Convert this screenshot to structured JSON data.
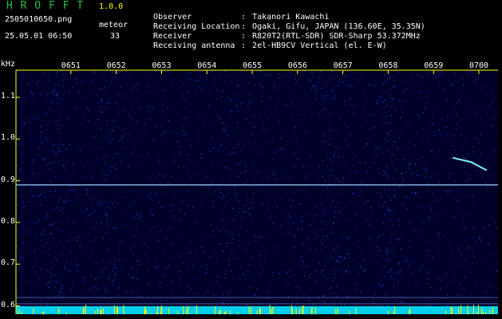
{
  "header": {
    "logo": "H R O F F T",
    "version": "1.0.0",
    "filename": "2505010650.png",
    "meteor_label": "meteor",
    "datetime": "25.05.01 06:50",
    "meteor_count": "33",
    "colors": {
      "logo": "#22c24a",
      "version": "#ffff00",
      "text": "#ffffff"
    }
  },
  "info": [
    {
      "key": "Observer",
      "value": "Takanori Kawachi"
    },
    {
      "key": "Receiving Location",
      "value": "Ogaki, Gifu, JAPAN (136.60E, 35.35N)"
    },
    {
      "key": "Receiver",
      "value": "R820T2(RTL-SDR) SDR-Sharp 53.372MHz"
    },
    {
      "key": "Receiving antenna",
      "value": "2el-HB9CV Vertical (el. E-W)"
    }
  ],
  "chart_data": {
    "type": "heatmap",
    "y_unit": "kHz",
    "x_ticks": [
      "0651",
      "0652",
      "0653",
      "0654",
      "0655",
      "0656",
      "0657",
      "0658",
      "0659",
      "0700"
    ],
    "y_ticks": [
      "1.1",
      "1.0",
      "0.9",
      "0.8",
      "0.7",
      "0.6"
    ],
    "y_tick_values": [
      1.1,
      1.0,
      0.9,
      0.8,
      0.7,
      0.6
    ],
    "ylim": [
      0.58,
      1.165
    ],
    "x_range_minutes": [
      0,
      10
    ],
    "carrier_line_khz": 0.89,
    "lower_lines_khz": [
      0.62,
      0.605
    ],
    "meteor_trace": [
      {
        "minute": 9.0,
        "khz": 0.955
      },
      {
        "minute": 9.4,
        "khz": 0.945
      },
      {
        "minute": 9.75,
        "khz": 0.925
      }
    ],
    "bright_columns_minutes": [
      0.2,
      1.4,
      4.1,
      6.3,
      7.6
    ],
    "colors": {
      "background": "#00002a",
      "noise": "#2a4fff",
      "carrier": "#9fd6ff",
      "trace": "#7ff2ff",
      "baseline": "#00e5ff",
      "tick_marks": "#ffff00",
      "labels": "#ffffff"
    }
  }
}
